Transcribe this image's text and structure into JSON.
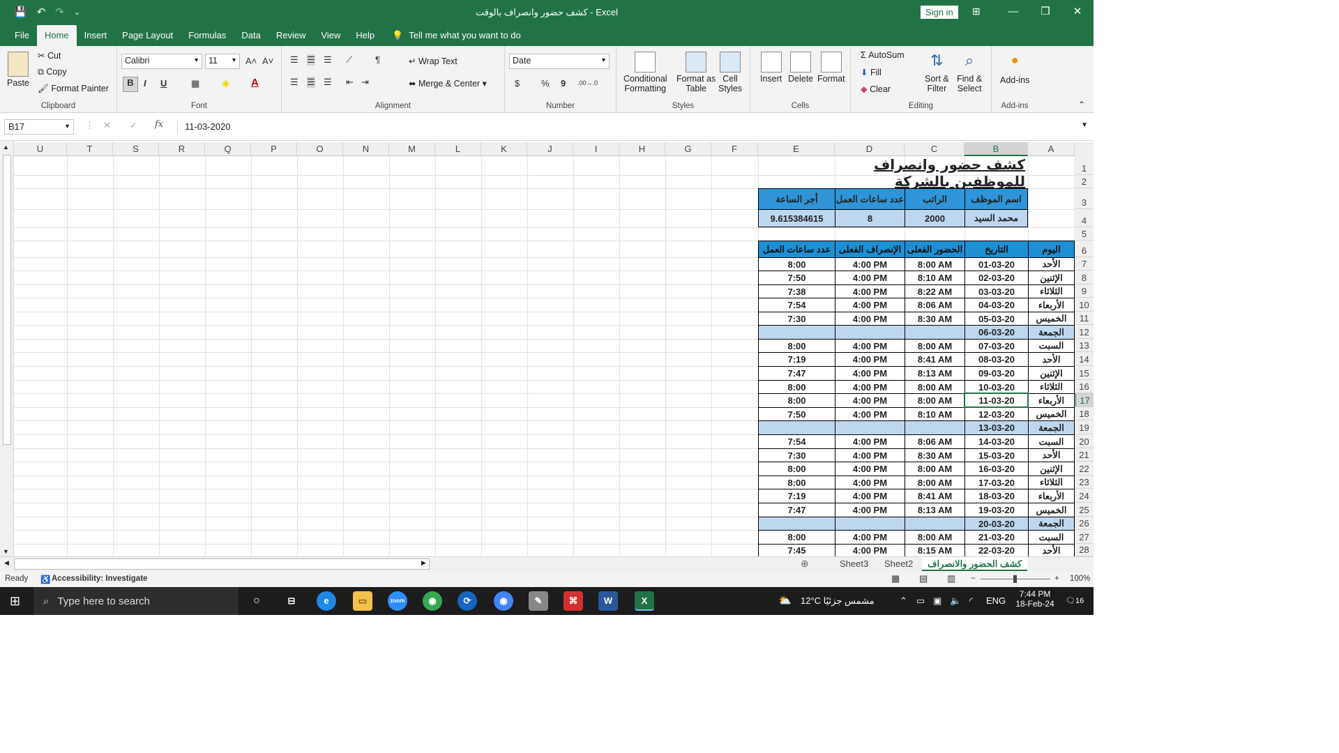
{
  "window": {
    "title": "كشف حضور وانصراف بالوقت  -  Excel",
    "signin_label": "Sign in",
    "controls": [
      "—",
      "❐",
      "✕"
    ],
    "ribbon_display_icon": "⊞"
  },
  "qat": {
    "save": "💾",
    "undo": "↶",
    "redo": "↷",
    "customize": "⌄"
  },
  "menu": {
    "tabs": [
      "File",
      "Home",
      "Insert",
      "Page Layout",
      "Formulas",
      "Data",
      "Review",
      "View",
      "Help"
    ],
    "tell_me": "Tell me what you want to do",
    "comment_icon": "🗨"
  },
  "ribbon": {
    "clipboard": {
      "label": "Clipboard",
      "paste": "Paste",
      "cut": "Cut",
      "copy": "Copy",
      "format_painter": "Format Painter"
    },
    "font": {
      "label": "Font",
      "font_name": "Calibri",
      "font_size": "11",
      "bold": "B",
      "italic": "I",
      "underline": "U",
      "grow": "A˄",
      "shrink": "A˅"
    },
    "alignment": {
      "label": "Alignment",
      "wrap_text": "Wrap Text",
      "merge_center": "Merge & Center"
    },
    "number": {
      "label": "Number",
      "format": "Date",
      "currency": "$",
      "percent": "%",
      "comma": "9",
      "inc_decimal": ".00→.0",
      "dec_decimal": ".0→.00"
    },
    "styles": {
      "label": "Styles",
      "conditional": [
        "Conditional",
        "Formatting"
      ],
      "format_table": [
        "Format as",
        "Table"
      ],
      "cell_styles": [
        "Cell",
        "Styles"
      ]
    },
    "cells": {
      "label": "Cells",
      "insert": "Insert",
      "delete": "Delete",
      "format": "Format"
    },
    "editing": {
      "label": "Editing",
      "autosum": "AutoSum",
      "fill": "Fill",
      "clear": "Clear",
      "sort_filter": [
        "Sort &",
        "Filter"
      ],
      "find_select": [
        "Find &",
        "Select"
      ]
    },
    "addins": {
      "label": "Add-ins",
      "addins": "Add-ins"
    }
  },
  "formula_bar": {
    "name_box": "B17",
    "fx": "fx",
    "formula": "11-03-2020"
  },
  "columns": [
    "U",
    "T",
    "S",
    "R",
    "Q",
    "P",
    "O",
    "N",
    "M",
    "L",
    "K",
    "J",
    "I",
    "H",
    "G",
    "F",
    "E",
    "D",
    "C",
    "B",
    "A"
  ],
  "rows": [
    "1",
    "2",
    "3",
    "4",
    "5",
    "6",
    "7",
    "8",
    "9",
    "10",
    "11",
    "12",
    "13",
    "14",
    "15",
    "16",
    "17",
    "18",
    "19",
    "20",
    "21",
    "22",
    "23",
    "24",
    "25",
    "26",
    "27",
    "28"
  ],
  "sheet": {
    "title": "كشف حضور وانصراف للموظفين بالشركة",
    "info_headers": [
      "اسم الموظف",
      "الراتب",
      "عدد ساعات العمل",
      "أجر الساعة"
    ],
    "info_values": [
      "محمد السيد",
      "2000",
      "8",
      "9.615384615"
    ],
    "table_headers": [
      "اليوم",
      "التاريخ",
      "الحضور الفعلى",
      "الإنصراف الفعلى",
      "عدد ساعات العمل"
    ],
    "table_rows": [
      [
        "الأحد",
        "01-03-20",
        "8:00 AM",
        "4:00 PM",
        "8:00"
      ],
      [
        "الإثنين",
        "02-03-20",
        "8:10 AM",
        "4:00 PM",
        "7:50"
      ],
      [
        "الثلاثاء",
        "03-03-20",
        "8:22 AM",
        "4:00 PM",
        "7:38"
      ],
      [
        "الأربعاء",
        "04-03-20",
        "8:06 AM",
        "4:00 PM",
        "7:54"
      ],
      [
        "الخميس",
        "05-03-20",
        "8:30 AM",
        "4:00 PM",
        "7:30"
      ],
      [
        "الجمعة",
        "06-03-20",
        "",
        "",
        ""
      ],
      [
        "السبت",
        "07-03-20",
        "8:00 AM",
        "4:00 PM",
        "8:00"
      ],
      [
        "الأحد",
        "08-03-20",
        "8:41 AM",
        "4:00 PM",
        "7:19"
      ],
      [
        "الإثنين",
        "09-03-20",
        "8:13 AM",
        "4:00 PM",
        "7:47"
      ],
      [
        "الثلاثاء",
        "10-03-20",
        "8:00 AM",
        "4:00 PM",
        "8:00"
      ],
      [
        "الأربعاء",
        "11-03-20",
        "8:00 AM",
        "4:00 PM",
        "8:00"
      ],
      [
        "الخميس",
        "12-03-20",
        "8:10 AM",
        "4:00 PM",
        "7:50"
      ],
      [
        "الجمعة",
        "13-03-20",
        "",
        "",
        ""
      ],
      [
        "السبت",
        "14-03-20",
        "8:06 AM",
        "4:00 PM",
        "7:54"
      ],
      [
        "الأحد",
        "15-03-20",
        "8:30 AM",
        "4:00 PM",
        "7:30"
      ],
      [
        "الإثنين",
        "16-03-20",
        "8:00 AM",
        "4:00 PM",
        "8:00"
      ],
      [
        "الثلاثاء",
        "17-03-20",
        "8:00 AM",
        "4:00 PM",
        "8:00"
      ],
      [
        "الأربعاء",
        "18-03-20",
        "8:41 AM",
        "4:00 PM",
        "7:19"
      ],
      [
        "الخميس",
        "19-03-20",
        "8:13 AM",
        "4:00 PM",
        "7:47"
      ],
      [
        "الجمعة",
        "20-03-20",
        "",
        "",
        ""
      ],
      [
        "السبت",
        "21-03-20",
        "8:00 AM",
        "4:00 PM",
        "8:00"
      ],
      [
        "الأحد",
        "22-03-20",
        "8:15 AM",
        "4:00 PM",
        "7:45"
      ]
    ]
  },
  "sheet_tabs": [
    "Sheet3",
    "Sheet2",
    "كشف الحضور والانصراف"
  ],
  "status": {
    "ready": "Ready",
    "accessibility": "Accessibility: Investigate",
    "zoom": "100%"
  },
  "taskbar": {
    "search_placeholder": "Type here to search",
    "weather": "12°C  مشمس جزئيًا",
    "lang": "ENG",
    "time": "7:44 PM",
    "date": "18-Feb-24",
    "notifications": "16"
  },
  "colors": {
    "excel_green": "#217346",
    "header_blue": "#1f8fd3",
    "light_blue": "#bdd7ee"
  }
}
